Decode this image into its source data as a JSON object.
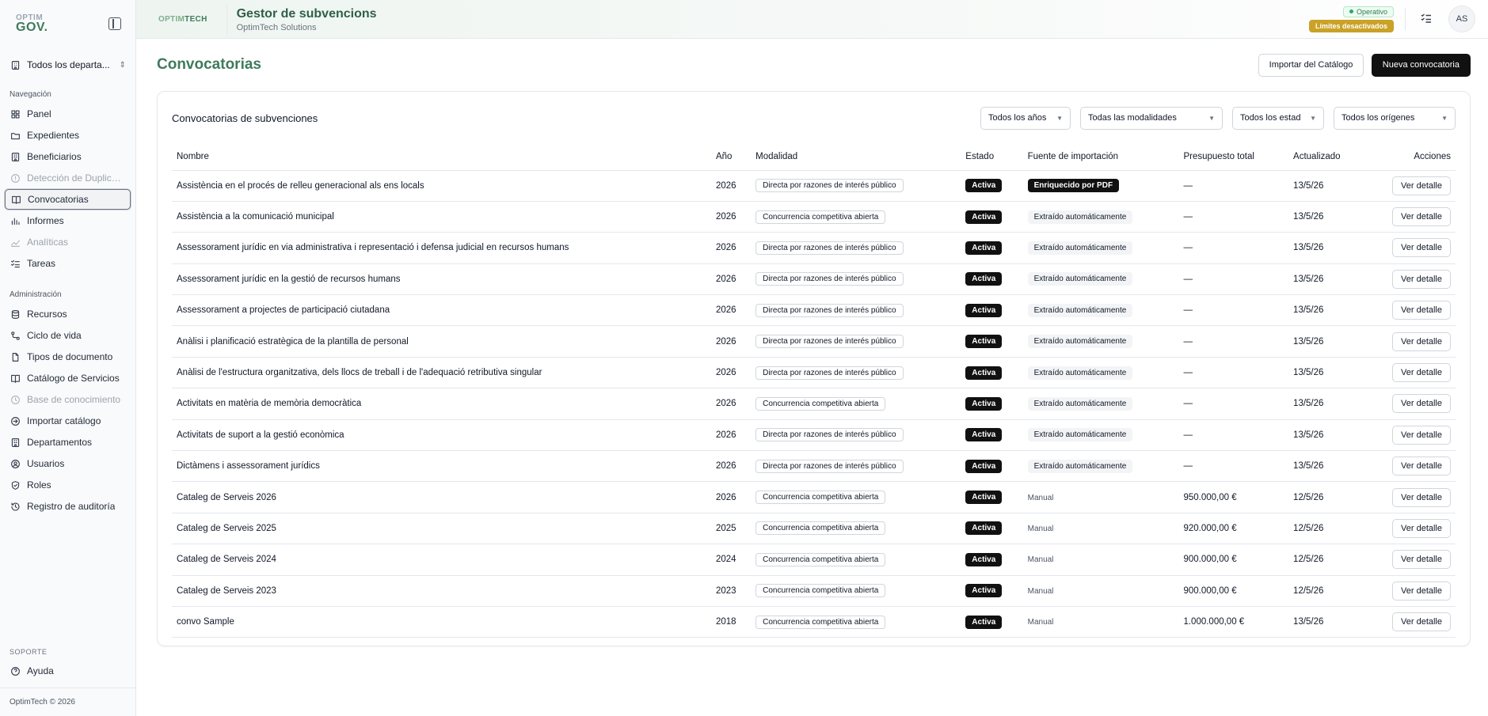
{
  "sidebar": {
    "logo_top": "OPTIM",
    "logo_bottom": "GOV.",
    "department": "Todos los departa...",
    "nav_heading": "Navegación",
    "nav": [
      {
        "label": "Panel",
        "icon": "grid-icon"
      },
      {
        "label": "Expedientes",
        "icon": "folder-icon"
      },
      {
        "label": "Beneficiarios",
        "icon": "building-icon"
      },
      {
        "label": "Detección de Duplicad...",
        "icon": "alert-circle-icon"
      },
      {
        "label": "Convocatorias",
        "icon": "book-icon"
      },
      {
        "label": "Informes",
        "icon": "bar-chart-icon"
      },
      {
        "label": "Analíticas",
        "icon": "trend-icon"
      },
      {
        "label": "Tareas",
        "icon": "checklist-icon"
      }
    ],
    "admin_heading": "Administración",
    "admin": [
      {
        "label": "Recursos",
        "icon": "database-icon"
      },
      {
        "label": "Ciclo de vida",
        "icon": "workflow-icon"
      },
      {
        "label": "Tipos de documento",
        "icon": "file-icon"
      },
      {
        "label": "Catálogo de Servicios",
        "icon": "book-open-icon"
      },
      {
        "label": "Base de conocimiento",
        "icon": "lightbulb-icon"
      },
      {
        "label": "Importar catálogo",
        "icon": "import-icon"
      },
      {
        "label": "Departamentos",
        "icon": "building-icon"
      },
      {
        "label": "Usuarios",
        "icon": "users-icon"
      },
      {
        "label": "Roles",
        "icon": "shield-icon"
      },
      {
        "label": "Registro de auditoría",
        "icon": "history-icon"
      }
    ],
    "support_heading": "SOPORTE",
    "help_label": "Ayuda",
    "footer": "OptimTech © 2026"
  },
  "topbar": {
    "logo_a": "OPTIM",
    "logo_b": "TECH",
    "title": "Gestor de subvencions",
    "subtitle": "OptimTech Solutions",
    "status": "Operativo",
    "limits": "Límites desactivados",
    "avatar": "AS"
  },
  "page": {
    "title": "Convocatorias",
    "import_button": "Importar del Catálogo",
    "new_button": "Nueva convocatoria"
  },
  "card": {
    "title": "Convocatorias de subvenciones",
    "filters": {
      "year": "Todos los años",
      "modality": "Todas las modalidades",
      "state": "Todos los estad",
      "origin": "Todos los orígenes"
    }
  },
  "table": {
    "headers": {
      "name": "Nombre",
      "year": "Año",
      "modality": "Modalidad",
      "state": "Estado",
      "source": "Fuente de importación",
      "budget": "Presupuesto total",
      "updated": "Actualizado",
      "actions": "Acciones"
    },
    "rows": [
      {
        "name": "Assistència en el procés de relleu generacional als ens locals",
        "year": "2026",
        "modality": "Directa por razones de interés público",
        "state": "Activa",
        "source": "Enriquecido por PDF",
        "budget": "—",
        "updated": "13/5/26",
        "action": "Ver detalle"
      },
      {
        "name": "Assistència a la comunicació municipal",
        "year": "2026",
        "modality": "Concurrencia competitiva abierta",
        "state": "Activa",
        "source": "Extraído automáticamente",
        "budget": "—",
        "updated": "13/5/26",
        "action": "Ver detalle"
      },
      {
        "name": "Assessorament jurídic en via administrativa i representació i defensa judicial en recursos humans",
        "year": "2026",
        "modality": "Directa por razones de interés público",
        "state": "Activa",
        "source": "Extraído automáticamente",
        "budget": "—",
        "updated": "13/5/26",
        "action": "Ver detalle"
      },
      {
        "name": "Assessorament jurídic en la gestió de recursos humans",
        "year": "2026",
        "modality": "Directa por razones de interés público",
        "state": "Activa",
        "source": "Extraído automáticamente",
        "budget": "—",
        "updated": "13/5/26",
        "action": "Ver detalle"
      },
      {
        "name": "Assessorament a projectes de participació ciutadana",
        "year": "2026",
        "modality": "Directa por razones de interés público",
        "state": "Activa",
        "source": "Extraído automáticamente",
        "budget": "—",
        "updated": "13/5/26",
        "action": "Ver detalle"
      },
      {
        "name": "Anàlisi i planificació estratègica de la plantilla de personal",
        "year": "2026",
        "modality": "Directa por razones de interés público",
        "state": "Activa",
        "source": "Extraído automáticamente",
        "budget": "—",
        "updated": "13/5/26",
        "action": "Ver detalle"
      },
      {
        "name": "Anàlisi de l'estructura organitzativa, dels llocs de treball i de l'adequació retributiva singular",
        "year": "2026",
        "modality": "Directa por razones de interés público",
        "state": "Activa",
        "source": "Extraído automáticamente",
        "budget": "—",
        "updated": "13/5/26",
        "action": "Ver detalle"
      },
      {
        "name": "Activitats en matèria de memòria democràtica",
        "year": "2026",
        "modality": "Concurrencia competitiva abierta",
        "state": "Activa",
        "source": "Extraído automáticamente",
        "budget": "—",
        "updated": "13/5/26",
        "action": "Ver detalle"
      },
      {
        "name": "Activitats de suport a la gestió econòmica",
        "year": "2026",
        "modality": "Directa por razones de interés público",
        "state": "Activa",
        "source": "Extraído automáticamente",
        "budget": "—",
        "updated": "13/5/26",
        "action": "Ver detalle"
      },
      {
        "name": "Dictàmens i assessorament jurídics",
        "year": "2026",
        "modality": "Directa por razones de interés público",
        "state": "Activa",
        "source": "Extraído automáticamente",
        "budget": "—",
        "updated": "13/5/26",
        "action": "Ver detalle"
      },
      {
        "name": "Cataleg de Serveis 2026",
        "year": "2026",
        "modality": "Concurrencia competitiva abierta",
        "state": "Activa",
        "source": "Manual",
        "budget": "950.000,00 €",
        "updated": "12/5/26",
        "action": "Ver detalle"
      },
      {
        "name": "Cataleg de Serveis 2025",
        "year": "2025",
        "modality": "Concurrencia competitiva abierta",
        "state": "Activa",
        "source": "Manual",
        "budget": "920.000,00 €",
        "updated": "12/5/26",
        "action": "Ver detalle"
      },
      {
        "name": "Cataleg de Serveis 2024",
        "year": "2024",
        "modality": "Concurrencia competitiva abierta",
        "state": "Activa",
        "source": "Manual",
        "budget": "900.000,00 €",
        "updated": "12/5/26",
        "action": "Ver detalle"
      },
      {
        "name": "Cataleg de Serveis 2023",
        "year": "2023",
        "modality": "Concurrencia competitiva abierta",
        "state": "Activa",
        "source": "Manual",
        "budget": "900.000,00 €",
        "updated": "12/5/26",
        "action": "Ver detalle"
      },
      {
        "name": "convo Sample",
        "year": "2018",
        "modality": "Concurrencia competitiva abierta",
        "state": "Activa",
        "source": "Manual",
        "budget": "1.000.000,00 €",
        "updated": "13/5/26",
        "action": "Ver detalle"
      }
    ]
  },
  "colors": {
    "brand_green": "#3f7a5c",
    "badge_gold": "#c9a227",
    "dark": "#111111"
  }
}
